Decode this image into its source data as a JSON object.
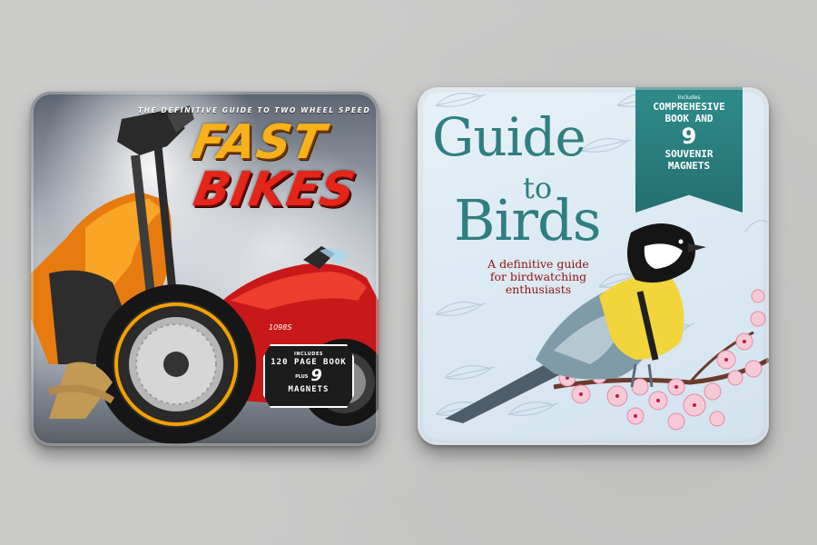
{
  "fast_bikes": {
    "tagline": "THE DEFINITIVE GUIDE TO TWO WHEEL SPEED",
    "title_line1": "FAST",
    "title_line2": "BIKES",
    "badge": {
      "top": "INCLUDES",
      "line1": "120 PAGE BOOK",
      "plus": "PLUS",
      "number": "9",
      "line2": "MAGNETS"
    },
    "colors": {
      "fast": "#f7b21a",
      "bikes": "#e52519",
      "bike_orange": "#f08a12",
      "bike_red": "#d81d1a"
    }
  },
  "guide_birds": {
    "title_word1": "Guide",
    "title_word2": "to",
    "title_word3": "Birds",
    "subtitle_line1": "A definitive guide",
    "subtitle_line2": "for birdwatching",
    "subtitle_line3": "enthusiasts",
    "ribbon": {
      "top": "Includes",
      "line1": "COMPREHESIVE",
      "line2": "BOOK AND",
      "number": "9",
      "line3": "SOUVENIR",
      "line4": "MAGNETS"
    },
    "colors": {
      "title": "#2f7f80",
      "subtitle": "#8f1313",
      "ribbon": "#2e8c8b"
    }
  }
}
